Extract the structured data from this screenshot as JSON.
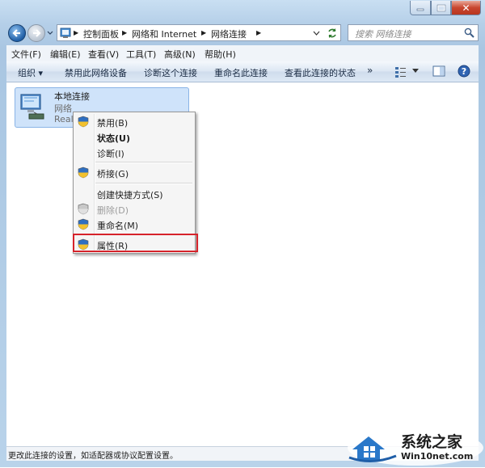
{
  "window": {
    "close_glyph": "✕",
    "min_glyph": "",
    "max_glyph": ""
  },
  "address": {
    "crumbs": [
      "控制面板",
      "网络和 Internet",
      "网络连接"
    ],
    "search_placeholder": "搜索 网络连接"
  },
  "menubar": [
    "文件(F)",
    "编辑(E)",
    "查看(V)",
    "工具(T)",
    "高级(N)",
    "帮助(H)"
  ],
  "cmdbar": {
    "organize": "组织 ▾",
    "items": [
      "禁用此网络设备",
      "诊断这个连接",
      "重命名此连接",
      "查看此连接的状态"
    ],
    "more": "»"
  },
  "item": {
    "name": "本地连接",
    "line2": "网络",
    "line3": "Realt"
  },
  "context_menu": {
    "items": [
      {
        "label": "禁用(B)",
        "shield": true,
        "bold": false,
        "disabled": false
      },
      {
        "label": "状态(U)",
        "shield": false,
        "bold": true,
        "disabled": false
      },
      {
        "label": "诊断(I)",
        "shield": false,
        "bold": false,
        "disabled": false
      },
      {
        "label": "桥接(G)",
        "shield": true,
        "bold": false,
        "disabled": false
      },
      {
        "label": "创建快捷方式(S)",
        "shield": false,
        "bold": false,
        "disabled": false
      },
      {
        "label": "删除(D)",
        "shield": true,
        "bold": false,
        "disabled": true
      },
      {
        "label": "重命名(M)",
        "shield": true,
        "bold": false,
        "disabled": false
      },
      {
        "label": "属性(R)",
        "shield": true,
        "bold": false,
        "disabled": false
      }
    ]
  },
  "status": "更改此连接的设置，如适配器或协议配置设置。",
  "watermark": {
    "title": "系统之家",
    "url": "Win10net.com"
  },
  "colors": {
    "highlight_border": "#d6232b",
    "selection": "#cfe3fa"
  }
}
